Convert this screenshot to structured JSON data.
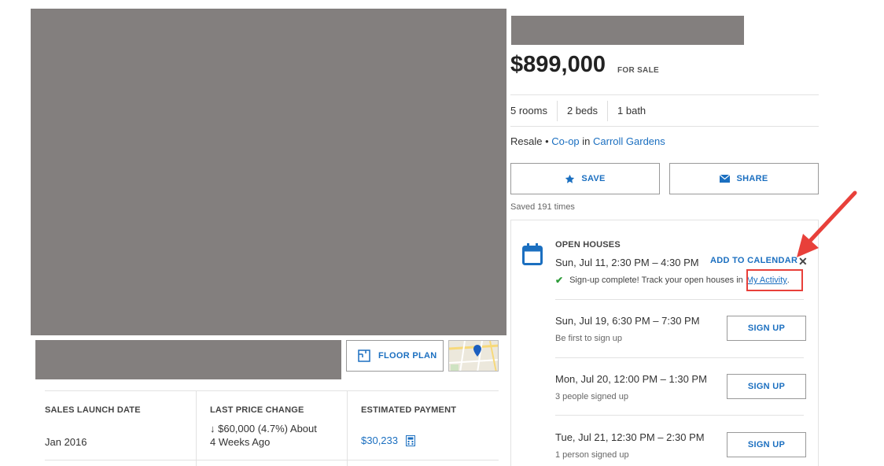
{
  "listing": {
    "price": "$899,000",
    "status_tag": "FOR SALE",
    "details": [
      "5 rooms",
      "2 beds",
      "1 bath"
    ],
    "type_line": {
      "prefix": "Resale • ",
      "type_link": "Co-op",
      "middle": " in ",
      "area_link": "Carroll Gardens"
    }
  },
  "actions": {
    "save_label": "SAVE",
    "share_label": "SHARE",
    "saved_count": "Saved 191 times"
  },
  "media": {
    "floor_plan_label": "FLOOR PLAN"
  },
  "facts": {
    "launch": {
      "heading": "SALES LAUNCH DATE",
      "value": "Jan 2016"
    },
    "price_change": {
      "heading": "LAST PRICE CHANGE",
      "value": "↓ $60,000 (4.7%) About",
      "value2": "4 Weeks Ago"
    },
    "payment": {
      "heading": "ESTIMATED PAYMENT",
      "value": "$30,233"
    }
  },
  "open_houses": {
    "title": "OPEN HOUSES",
    "registered": {
      "date": "Sun, Jul 11, 2:30 PM – 4:30 PM",
      "add_calendar": "ADD TO CALENDAR",
      "close": "✕",
      "confirm_text": "Sign-up complete! Track your open houses in",
      "confirm_link": "My Activity",
      "confirm_end": "."
    },
    "slots": [
      {
        "date": "Sun, Jul 19, 6:30 PM – 7:30 PM",
        "note": "Be first to sign up",
        "button": "SIGN UP"
      },
      {
        "date": "Mon, Jul 20, 12:00 PM – 1:30 PM",
        "note": "3 people signed up",
        "button": "SIGN UP"
      },
      {
        "date": "Tue, Jul 21, 12:30 PM – 2:30 PM",
        "note": "1 person signed up",
        "button": "SIGN UP"
      }
    ]
  },
  "colors": {
    "accent": "#1b6fc0",
    "placeholder": "#837f7e",
    "annotation": "#e8403a",
    "success": "#2e9c3a"
  }
}
